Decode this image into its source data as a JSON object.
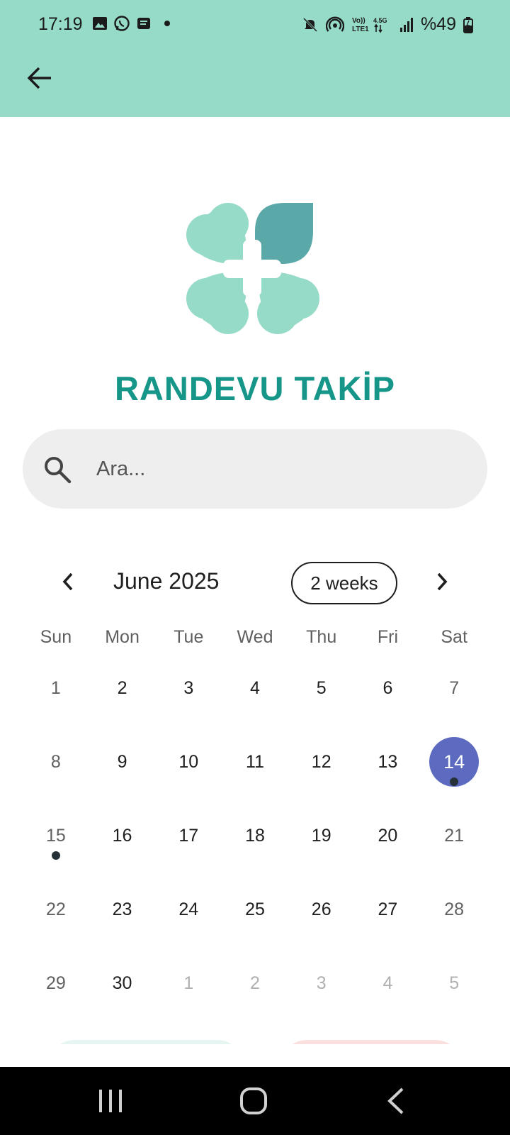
{
  "status_bar": {
    "time": "17:19",
    "battery": "%49",
    "left_icons": [
      "gallery-icon",
      "whatsapp-icon",
      "message-icon",
      "dot-icon"
    ],
    "right_icons": [
      "mute-icon",
      "hotspot-icon",
      "volte-icon",
      "signal-icon",
      "battery-icon"
    ]
  },
  "app_bar": {
    "back_icon": "arrow-back-icon"
  },
  "logo": {
    "colors": {
      "light": "#95dbc8",
      "dark": "#5ba8a8"
    }
  },
  "title": "RANDEVU TAKİP",
  "search": {
    "placeholder": "Ara...",
    "value": ""
  },
  "calendar": {
    "month": "June 2025",
    "format_button": "2 weeks",
    "weekdays": [
      "Sun",
      "Mon",
      "Tue",
      "Wed",
      "Thu",
      "Fri",
      "Sat"
    ],
    "days": [
      {
        "n": "1",
        "t": "weekend"
      },
      {
        "n": "2",
        "t": "weekday"
      },
      {
        "n": "3",
        "t": "weekday"
      },
      {
        "n": "4",
        "t": "weekday"
      },
      {
        "n": "5",
        "t": "weekday"
      },
      {
        "n": "6",
        "t": "weekday"
      },
      {
        "n": "7",
        "t": "weekend"
      },
      {
        "n": "8",
        "t": "weekend"
      },
      {
        "n": "9",
        "t": "weekday"
      },
      {
        "n": "10",
        "t": "weekday"
      },
      {
        "n": "11",
        "t": "weekday"
      },
      {
        "n": "12",
        "t": "weekday"
      },
      {
        "n": "13",
        "t": "weekday"
      },
      {
        "n": "14",
        "t": "weekend",
        "selected": true,
        "event": true
      },
      {
        "n": "15",
        "t": "weekend",
        "event": true
      },
      {
        "n": "16",
        "t": "weekday"
      },
      {
        "n": "17",
        "t": "weekday"
      },
      {
        "n": "18",
        "t": "weekday"
      },
      {
        "n": "19",
        "t": "weekday"
      },
      {
        "n": "20",
        "t": "weekday"
      },
      {
        "n": "21",
        "t": "weekend"
      },
      {
        "n": "22",
        "t": "weekend"
      },
      {
        "n": "23",
        "t": "weekday"
      },
      {
        "n": "24",
        "t": "weekday"
      },
      {
        "n": "25",
        "t": "weekday"
      },
      {
        "n": "26",
        "t": "weekday"
      },
      {
        "n": "27",
        "t": "weekday"
      },
      {
        "n": "28",
        "t": "weekend"
      },
      {
        "n": "29",
        "t": "weekend"
      },
      {
        "n": "30",
        "t": "weekday"
      },
      {
        "n": "1",
        "t": "outside"
      },
      {
        "n": "2",
        "t": "outside"
      },
      {
        "n": "3",
        "t": "outside"
      },
      {
        "n": "4",
        "t": "outside"
      },
      {
        "n": "5",
        "t": "outside"
      }
    ],
    "colors": {
      "selected": "#5c6bc0",
      "event_marker": "#263238"
    }
  },
  "colors": {
    "accent": "#95dbc8",
    "title": "#169688"
  }
}
